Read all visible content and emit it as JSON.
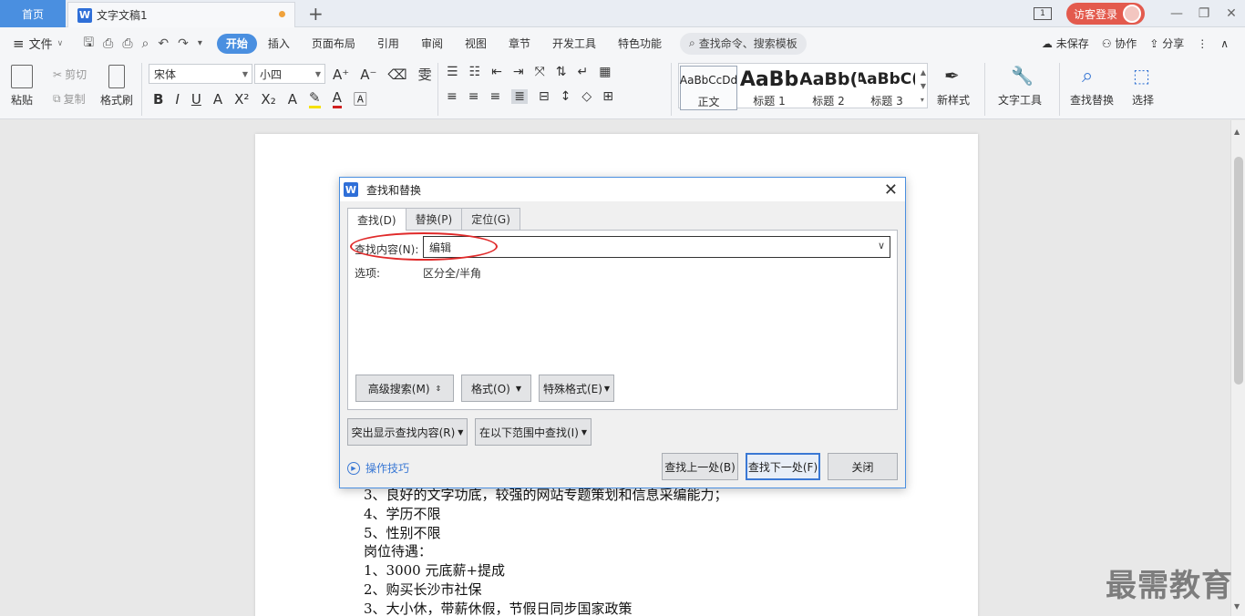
{
  "titlebar": {
    "home_tab": "首页",
    "doc_tab": "文字文稿1",
    "new_tab_icon": "plus-icon",
    "screen_badge": "1",
    "login": "访客登录"
  },
  "menubar": {
    "file": "文件",
    "items": [
      "开始",
      "插入",
      "页面布局",
      "引用",
      "审阅",
      "视图",
      "章节",
      "开发工具",
      "特色功能"
    ],
    "search": "查找命令、搜索模板",
    "unsaved": "未保存",
    "collab": "协作",
    "share": "分享"
  },
  "ribbon": {
    "paste": "粘贴",
    "cut": "剪切",
    "copy": "复制",
    "format_painter": "格式刷",
    "font_name": "宋体",
    "font_size": "小四",
    "styles": [
      {
        "preview": "AaBbCcDd",
        "label": "正文"
      },
      {
        "preview": "AaBb",
        "label": "标题 1"
      },
      {
        "preview": "AaBb(",
        "label": "标题 2"
      },
      {
        "preview": "AaBbC(",
        "label": "标题 3"
      }
    ],
    "new_style": "新样式",
    "text_tools": "文字工具",
    "find_replace": "查找替换",
    "select": "选择"
  },
  "document": {
    "lines": [
      "3、良好的文字功底，较强的网站专题策划和信息采编能力；",
      "4、学历不限",
      "5、性别不限",
      "岗位待遇：",
      "1、3000 元底薪+提成",
      "2、购买长沙市社保",
      "3、大小休，带薪休假，节假日同步国家政策"
    ],
    "watermark": "最需教育"
  },
  "dialog": {
    "title": "查找和替换",
    "tabs": [
      "查找(D)",
      "替换(P)",
      "定位(G)"
    ],
    "find_label": "查找内容(N):",
    "find_value": "编辑",
    "options_label": "选项:",
    "options_value": "区分全/半角",
    "advanced": "高级搜索(M)",
    "format": "格式(O)",
    "special": "特殊格式(E)",
    "highlight": "突出显示查找内容(R)",
    "find_in": "在以下范围中查找(I)",
    "tips": "操作技巧",
    "find_prev": "查找上一处(B)",
    "find_next": "查找下一处(F)",
    "close": "关闭"
  },
  "colors": {
    "accent": "#4a8fe0",
    "login_red": "#e35a4d",
    "annotation_red": "#e02a2a"
  }
}
